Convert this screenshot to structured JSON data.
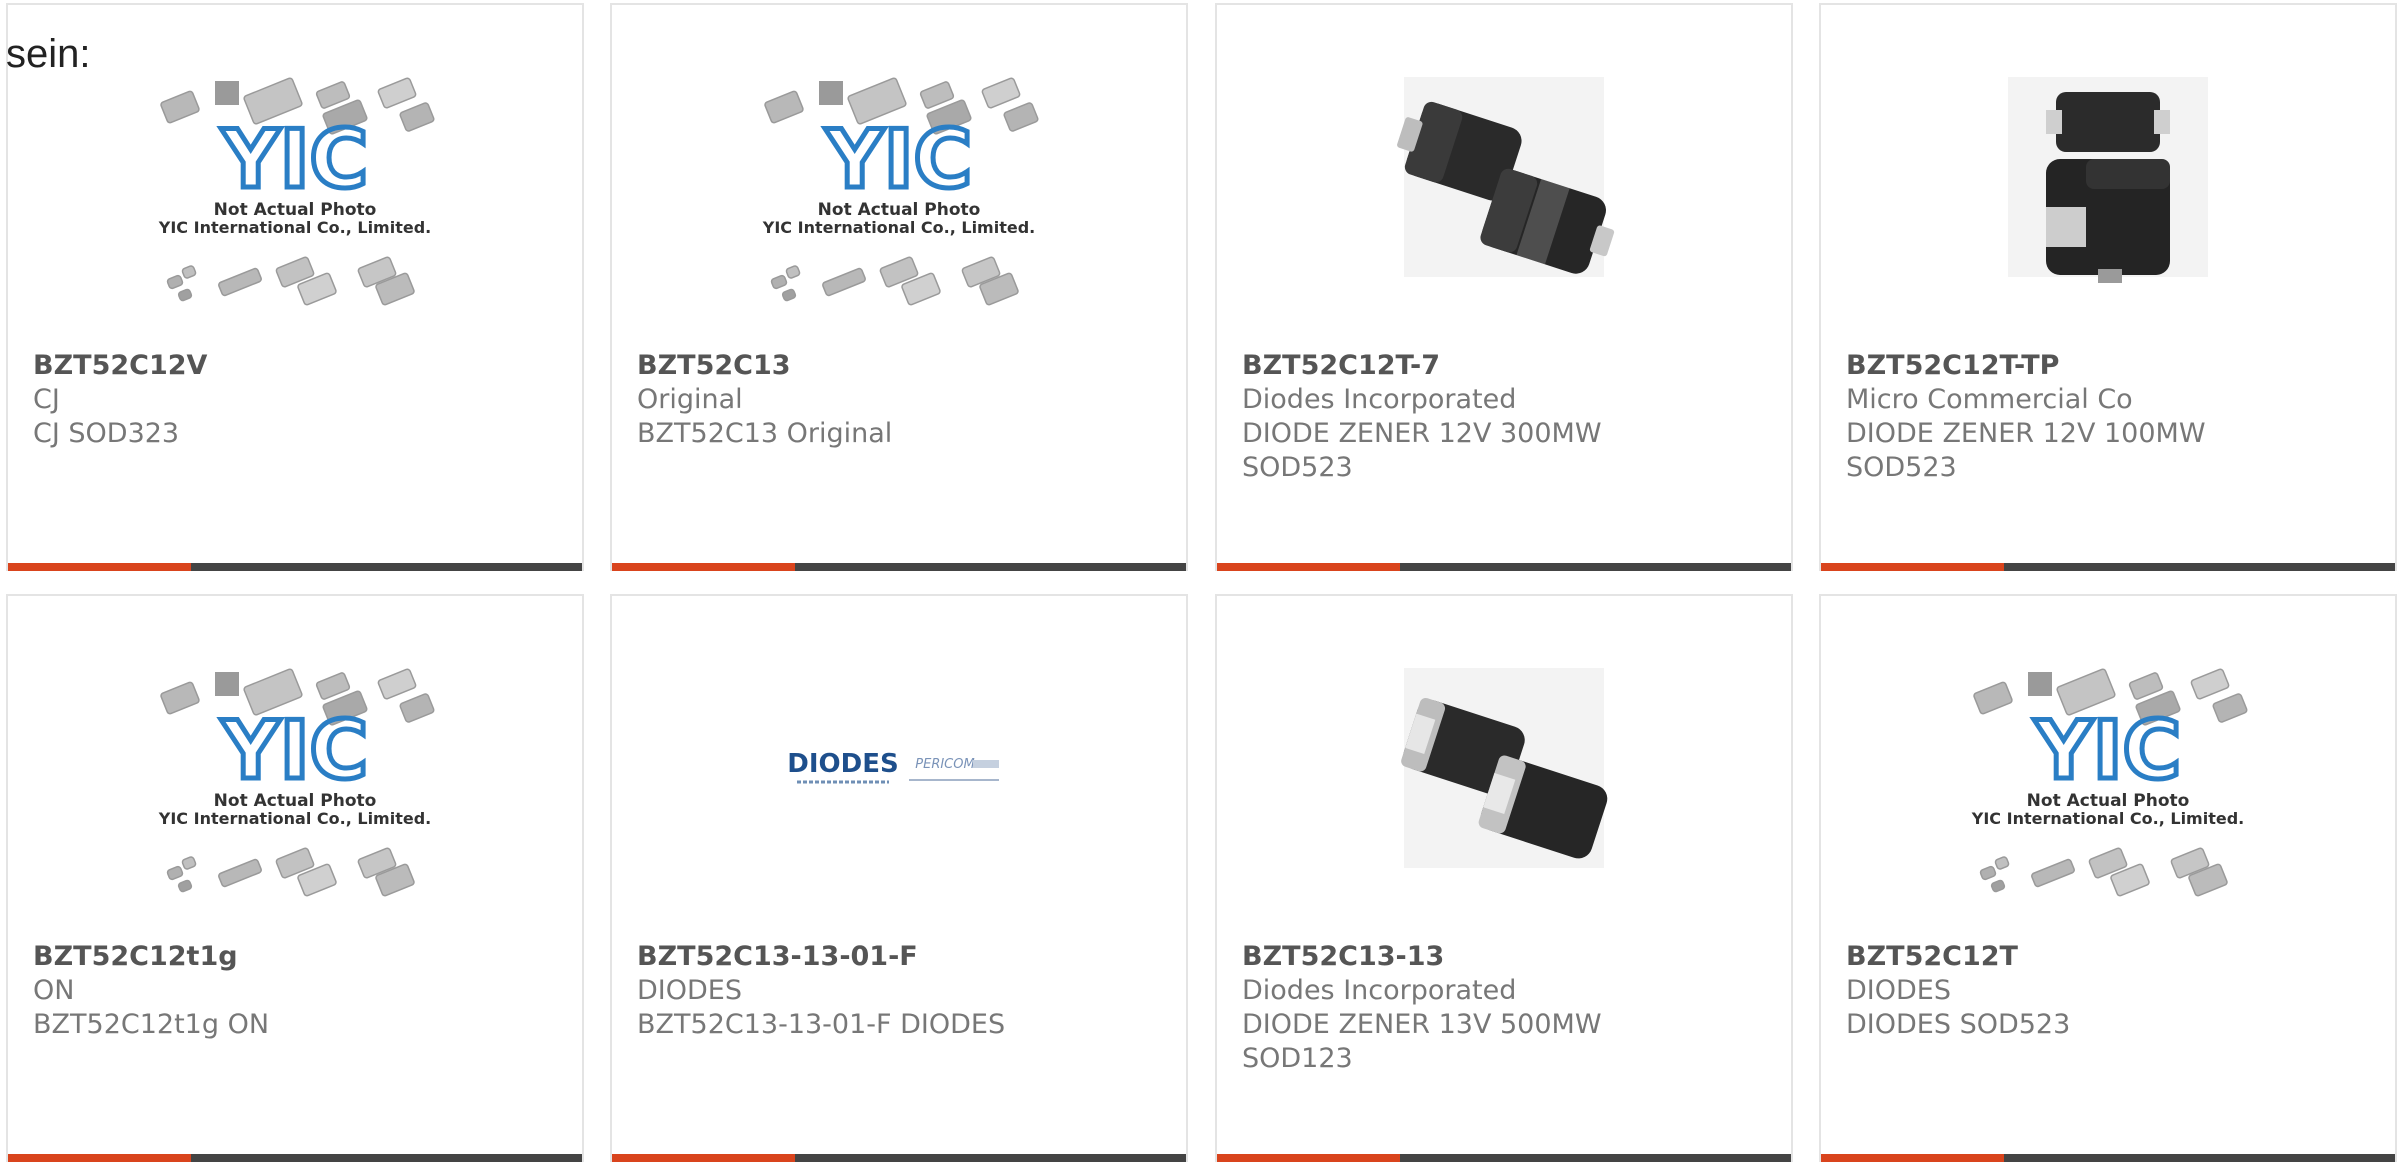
{
  "intro_text": "sein:",
  "colors": {
    "accent": "#d9441d",
    "bar": "#444444",
    "text": "#777777",
    "title": "#555555",
    "border": "#e4e4e4",
    "yic_blue": "#2a7ec5"
  },
  "placeholder": {
    "line1": "Not Actual Photo",
    "line2": "YIC International Co., Limited.",
    "logo": "YIC"
  },
  "brand_logo": {
    "left": "DIODES",
    "right": "PERICOM"
  },
  "products": [
    {
      "part": "BZT52C12V",
      "maker": "CJ",
      "desc": "CJ SOD323",
      "desc2": "",
      "image": "yic-placeholder"
    },
    {
      "part": "BZT52C13",
      "maker": "Original",
      "desc": "BZT52C13 Original",
      "desc2": "",
      "image": "yic-placeholder"
    },
    {
      "part": "BZT52C12T-7",
      "maker": "Diodes Incorporated",
      "desc": "DIODE ZENER 12V 300MW",
      "desc2": "SOD523",
      "image": "sod-package-photo"
    },
    {
      "part": "BZT52C12T-TP",
      "maker": "Micro Commercial Co",
      "desc": "DIODE ZENER 12V 100MW",
      "desc2": "SOD523",
      "image": "sod-package-photo"
    },
    {
      "part": "BZT52C12t1g",
      "maker": "ON",
      "desc": "BZT52C12t1g ON",
      "desc2": "",
      "image": "yic-placeholder"
    },
    {
      "part": "BZT52C13-13-01-F",
      "maker": "DIODES",
      "desc": "BZT52C13-13-01-F DIODES",
      "desc2": "",
      "image": "diodes-pericom-logo"
    },
    {
      "part": "BZT52C13-13",
      "maker": "Diodes Incorporated",
      "desc": "DIODE ZENER 13V 500MW",
      "desc2": "SOD123",
      "image": "sod-package-photo"
    },
    {
      "part": "BZT52C12T",
      "maker": "DIODES",
      "desc": "DIODES SOD523",
      "desc2": "",
      "image": "yic-placeholder"
    }
  ]
}
